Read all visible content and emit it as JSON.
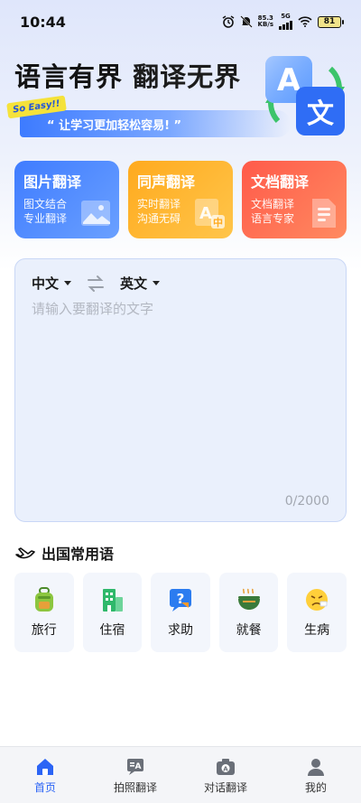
{
  "status_bar": {
    "time": "10:44",
    "net_speed": "85.3",
    "net_unit": "KB/s",
    "network": "5G",
    "battery": "81"
  },
  "hero": {
    "title_part1": "语言有界",
    "title_part2": "翻译无界",
    "badge": "So Easy!!",
    "slogan": "“ 让学习更加轻松容易! ”"
  },
  "features": [
    {
      "title": "图片翻译",
      "line1": "图文结合",
      "line2": "专业翻译",
      "icon": "image-icon"
    },
    {
      "title": "同声翻译",
      "line1": "实时翻译",
      "line2": "沟通无碍",
      "icon": "translate-ac-icon"
    },
    {
      "title": "文档翻译",
      "line1": "文档翻译",
      "line2": "语言专家",
      "icon": "document-icon"
    }
  ],
  "translator": {
    "source_lang": "中文",
    "target_lang": "英文",
    "placeholder": "请输入要翻译的文字",
    "char_count": "0/2000"
  },
  "phrases": {
    "title": "出国常用语",
    "items": [
      {
        "label": "旅行",
        "icon": "backpack-icon"
      },
      {
        "label": "住宿",
        "icon": "hotel-icon"
      },
      {
        "label": "求助",
        "icon": "help-icon"
      },
      {
        "label": "就餐",
        "icon": "noodle-bowl-icon"
      },
      {
        "label": "生病",
        "icon": "sick-face-icon"
      }
    ]
  },
  "bottom_nav": [
    {
      "label": "首页",
      "icon": "home-icon",
      "active": true
    },
    {
      "label": "拍照翻译",
      "icon": "photo-translate-icon",
      "active": false
    },
    {
      "label": "对话翻译",
      "icon": "camera-icon",
      "active": false
    },
    {
      "label": "我的",
      "icon": "profile-icon",
      "active": false
    }
  ],
  "colors": {
    "primary": "#2b64f5",
    "card_blue": "#3f7cff",
    "card_orange": "#ffaa1e",
    "card_red": "#ff5a4a"
  }
}
